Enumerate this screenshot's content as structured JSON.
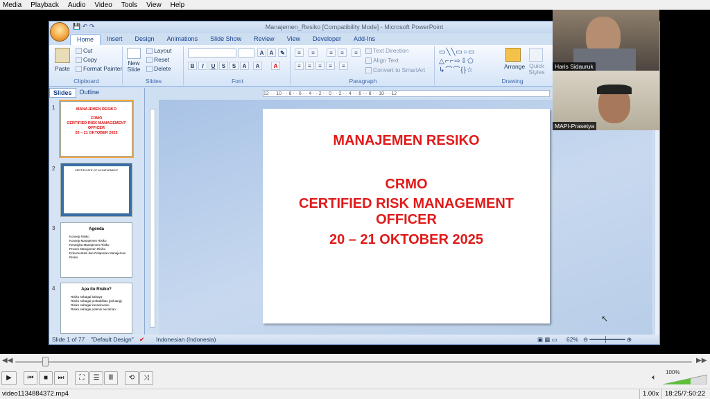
{
  "menu": [
    "Media",
    "Playback",
    "Audio",
    "Video",
    "Tools",
    "View",
    "Help"
  ],
  "ppt": {
    "title": "Manajemen_Resiko [Compatibility Mode] - Microsoft PowerPoint",
    "tabs": [
      "Home",
      "Insert",
      "Design",
      "Animations",
      "Slide Show",
      "Review",
      "View",
      "Developer",
      "Add-Ins"
    ],
    "clipboard": {
      "paste": "Paste",
      "cut": "Cut",
      "copy": "Copy",
      "format_painter": "Format Painter",
      "label": "Clipboard"
    },
    "slides_group": {
      "new_slide": "New Slide",
      "layout": "Layout",
      "reset": "Reset",
      "delete": "Delete",
      "label": "Slides"
    },
    "font_label": "Font",
    "paragraph": {
      "text_direction": "Text Direction",
      "align_text": "Align Text",
      "convert": "Convert to SmartArt",
      "label": "Paragraph"
    },
    "drawing": {
      "arrange": "Arrange",
      "quick_styles": "Quick Styles",
      "label": "Drawing"
    },
    "pane_tabs": [
      "Slides",
      "Outline"
    ],
    "thumbs": [
      {
        "num": "1",
        "lines": [
          "MANAJEMEN RESIKO",
          "",
          "CRMO",
          "CERTIFIED RISK MANAGEMENT",
          "OFFICER",
          "20 – 21 OKTOBER 2025"
        ]
      },
      {
        "num": "2",
        "title": "CERTIFICATE OF ACHIEVEMENT"
      },
      {
        "num": "3",
        "title": "Agenda",
        "items": [
          "Konsep Risiko",
          "Konsep Manajemen Risiko",
          "Kerangka Manajemen Risiko",
          "Proses Manajemen Risiko",
          "Dokumentasi dan Pelaporan Manajemen Risiko"
        ]
      },
      {
        "num": "4",
        "title": "Apa itu Risiko?",
        "items": [
          "Risiko sebagai bahaya",
          "Risiko sebagai probabilitas (peluang)",
          "Risiko sebagai konsekuensi",
          "Risiko sebagai potensi ancaman"
        ]
      }
    ],
    "slide": {
      "title": "MANAJEMEN RESIKO",
      "l1": "CRMO",
      "l2": "CERTIFIED RISK MANAGEMENT",
      "l3": "OFFICER",
      "l4": "20 – 21 OKTOBER 2025"
    },
    "status": {
      "slide": "Slide 1 of 77",
      "design": "\"Default Design\"",
      "lang": "Indonesian (Indonesia)",
      "zoom": "62%"
    }
  },
  "participants": [
    "Haris Sidauruk",
    "MAPI-Prasetya"
  ],
  "vlc": {
    "filename": "video1134884372.mp4",
    "speed": "1.00x",
    "time": "18:25/7:50:22",
    "volume": "100%",
    "progress": 0.04
  }
}
